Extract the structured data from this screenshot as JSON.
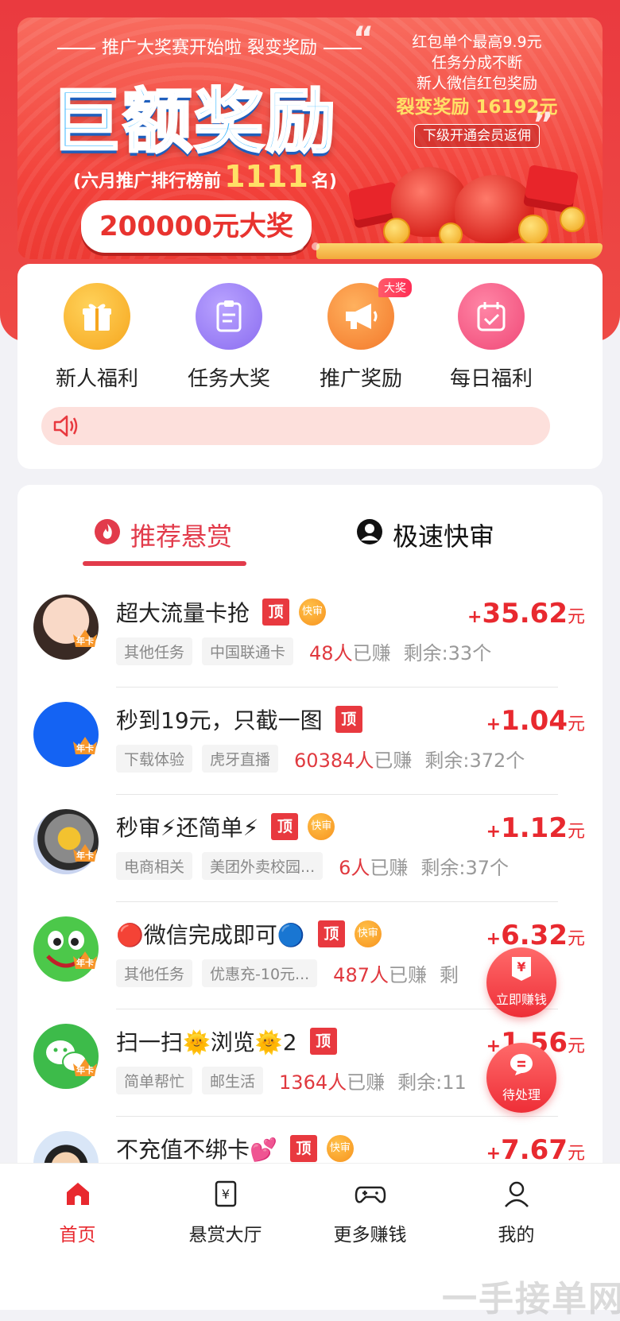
{
  "banner": {
    "subtitle": "推广大奖赛开始啦 裂变奖励",
    "headline": "巨额奖励",
    "rank_prefix": "(六月推广排行榜前",
    "rank_number": "1111",
    "rank_suffix": "名)",
    "prize": "200000元大奖",
    "right_line1": "红包单个最高9.9元",
    "right_line2": "任务分成不断",
    "right_line3": "新人微信红包奖励",
    "right_highlight": "裂变奖励 16192元",
    "right_tag": "下级开通会员返佣"
  },
  "quick_menu": [
    {
      "label": "新人福利",
      "icon": "gift-icon",
      "color": "#f7b02a"
    },
    {
      "label": "任务大奖",
      "icon": "clipboard-icon",
      "color": "#9b7df7"
    },
    {
      "label": "推广奖励",
      "icon": "megaphone-icon",
      "color": "#f58a2e",
      "badge": "大奖"
    },
    {
      "label": "每日福利",
      "icon": "calendar-check-icon",
      "color": "#f25c8a"
    }
  ],
  "tabs": {
    "recommended": "推荐悬赏",
    "fast": "极速快审"
  },
  "tags": {
    "ding": "顶",
    "kuai": "快审",
    "crown": "年卡",
    "earned_suffix": "已赚",
    "price_plus": "+",
    "price_unit": "元"
  },
  "tasks": [
    {
      "title": "超大流量卡抢",
      "ding": true,
      "kuai": true,
      "price": "35.62",
      "chips": [
        "其他任务",
        "中国联通卡"
      ],
      "earned": "48人",
      "remain": "剩余:33个"
    },
    {
      "title": "秒到19元，只截一图",
      "ding": true,
      "kuai": false,
      "price": "1.04",
      "chips": [
        "下载体验",
        "虎牙直播"
      ],
      "earned": "60384人",
      "remain": "剩余:372个"
    },
    {
      "title": "秒审⚡还简单⚡",
      "ding": true,
      "kuai": true,
      "price": "1.12",
      "chips": [
        "电商相关",
        "美团外卖校园..."
      ],
      "earned": "6人",
      "remain": "剩余:37个"
    },
    {
      "title": "🔴微信完成即可🔵",
      "ding": true,
      "kuai": true,
      "price": "6.32",
      "chips": [
        "其他任务",
        "优惠充-10元..."
      ],
      "earned": "487人",
      "remain": "剩"
    },
    {
      "title": "扫一扫🌞浏览🌞2",
      "ding": true,
      "kuai": false,
      "price": "1.56",
      "chips": [
        "简单帮忙",
        "邮生活"
      ],
      "earned": "1364人",
      "remain": "剩余:11"
    },
    {
      "title": "不充值不绑卡💕",
      "ding": true,
      "kuai": true,
      "price": "7.67",
      "chips": [],
      "earned": "",
      "remain": ""
    }
  ],
  "floats": {
    "earn_now": "立即赚钱",
    "pending": "待处理"
  },
  "bottom_nav": [
    {
      "label": "首页",
      "icon": "home-icon",
      "active": true
    },
    {
      "label": "悬赏大厅",
      "icon": "bounty-icon",
      "active": false
    },
    {
      "label": "更多赚钱",
      "icon": "gamepad-icon",
      "active": false
    },
    {
      "label": "我的",
      "icon": "user-icon",
      "active": false
    }
  ],
  "watermark": "一手接单网",
  "colors": {
    "brand_red": "#e8292f",
    "tab_active": "#e23b4b"
  }
}
